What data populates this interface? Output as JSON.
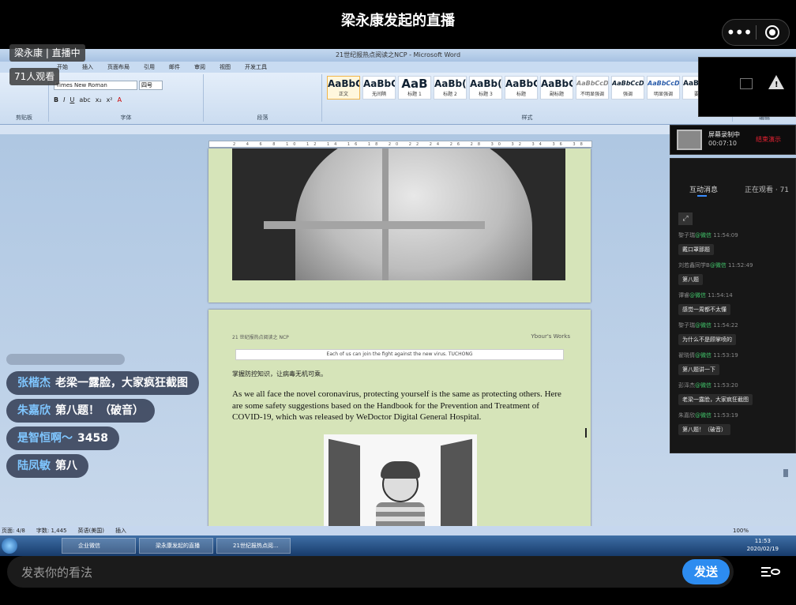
{
  "header": {
    "title": "梁永康发起的直播"
  },
  "overlay": {
    "host_status": "梁永康 | 直播中",
    "viewers": "71人观看"
  },
  "word": {
    "window_title": "21世纪报热点阅读之NCP - Microsoft Word",
    "tabs": [
      "开始",
      "插入",
      "页面布局",
      "引用",
      "邮件",
      "审阅",
      "视图",
      "开发工具"
    ],
    "font_name": "Times New Roman",
    "font_size": "四号",
    "groups": [
      "剪贴板",
      "字体",
      "段落",
      "样式",
      "编辑"
    ],
    "styles": [
      {
        "preview": "AaBbCcD",
        "name": "正文"
      },
      {
        "preview": "AaBbCcD",
        "name": "无间隔"
      },
      {
        "preview": "AaB",
        "name": "标题 1"
      },
      {
        "preview": "AaBb(",
        "name": "标题 2"
      },
      {
        "preview": "AaBb(",
        "name": "标题 3"
      },
      {
        "preview": "AaBbC",
        "name": "标题"
      },
      {
        "preview": "AaBbC",
        "name": "副标题"
      },
      {
        "preview": "AaBbCcDi",
        "name": "不明显强调"
      },
      {
        "preview": "AaBbCcDi",
        "name": "强调"
      },
      {
        "preview": "AaBbCcDi",
        "name": "明显强调"
      },
      {
        "preview": "AaBbCcD",
        "name": "要点"
      }
    ],
    "page2": {
      "header_left": "21 世纪报热点阅读之 NCP",
      "header_right": "Ybour's Works",
      "banner": "Each of us can join the fight against the new virus. TUCHONG",
      "cn_line": "掌握防控知识，让病毒无机可乘。",
      "paragraph": "As we all face the novel coronavirus, protecting yourself is the same as protecting others. Here are some safety suggestions based on the Handbook for the Prevention and Treatment of COVID-19, which was released by WeDoctor Digital General Hospital."
    },
    "status": {
      "page": "页面: 4/8",
      "words": "字数: 1,445",
      "lang": "英语(美国)",
      "mode": "插入",
      "zoom": "100%"
    }
  },
  "taskbar": {
    "items": [
      "企业微信",
      "梁永康发起的直播",
      "21世纪报热点阅..."
    ],
    "time": "11:53",
    "date": "2020/02/19"
  },
  "recorder": {
    "label": "屏幕录制中",
    "time": "00:07:10",
    "stop": "结束演示"
  },
  "chat_panel": {
    "tab_chat": "互动消息",
    "tab_watching": "正在观看 · 71",
    "messages": [
      {
        "user": "黎子瑞",
        "source": "@微信",
        "time": "11:54:09",
        "text": "戴口罩那题"
      },
      {
        "user": "刘若鑫同学B",
        "source": "@微信",
        "time": "11:52:49",
        "text": "第八题"
      },
      {
        "user": "谭睿",
        "source": "@微信",
        "time": "11:54:14",
        "text": "感觉一周都不太懂"
      },
      {
        "user": "黎子瑞",
        "source": "@微信",
        "time": "11:54:22",
        "text": "为什么不是顾掌喷的"
      },
      {
        "user": "翟晓倩",
        "source": "@微信",
        "time": "11:53:19",
        "text": "第八题讲一下"
      },
      {
        "user": "彭泽杰",
        "source": "@微信",
        "time": "11:53:20",
        "text": "老梁一露脸，大家疯狂截图"
      },
      {
        "user": "朱嘉欣",
        "source": "@微信",
        "time": "11:53:19",
        "text": "第八题！（破音）"
      }
    ]
  },
  "danmaku": [
    {
      "nick": "张楷杰",
      "text": "老梁一露脸，大家疯狂截图"
    },
    {
      "nick": "朱嘉欣",
      "text": "第八题！（破音）"
    },
    {
      "nick": "是智恒啊～",
      "text": "3458"
    },
    {
      "nick": "陆凤敏",
      "text": "第八"
    }
  ],
  "input": {
    "placeholder": "发表你的看法",
    "send_label": "发送"
  },
  "icons": {
    "more": "more-dots-icon",
    "close": "target-close-icon",
    "viewers_toggle": "eye-list-icon"
  },
  "colors": {
    "send": "#2d8cf0",
    "nick": "#7fc6ff",
    "wechat_source": "#41c46a"
  }
}
